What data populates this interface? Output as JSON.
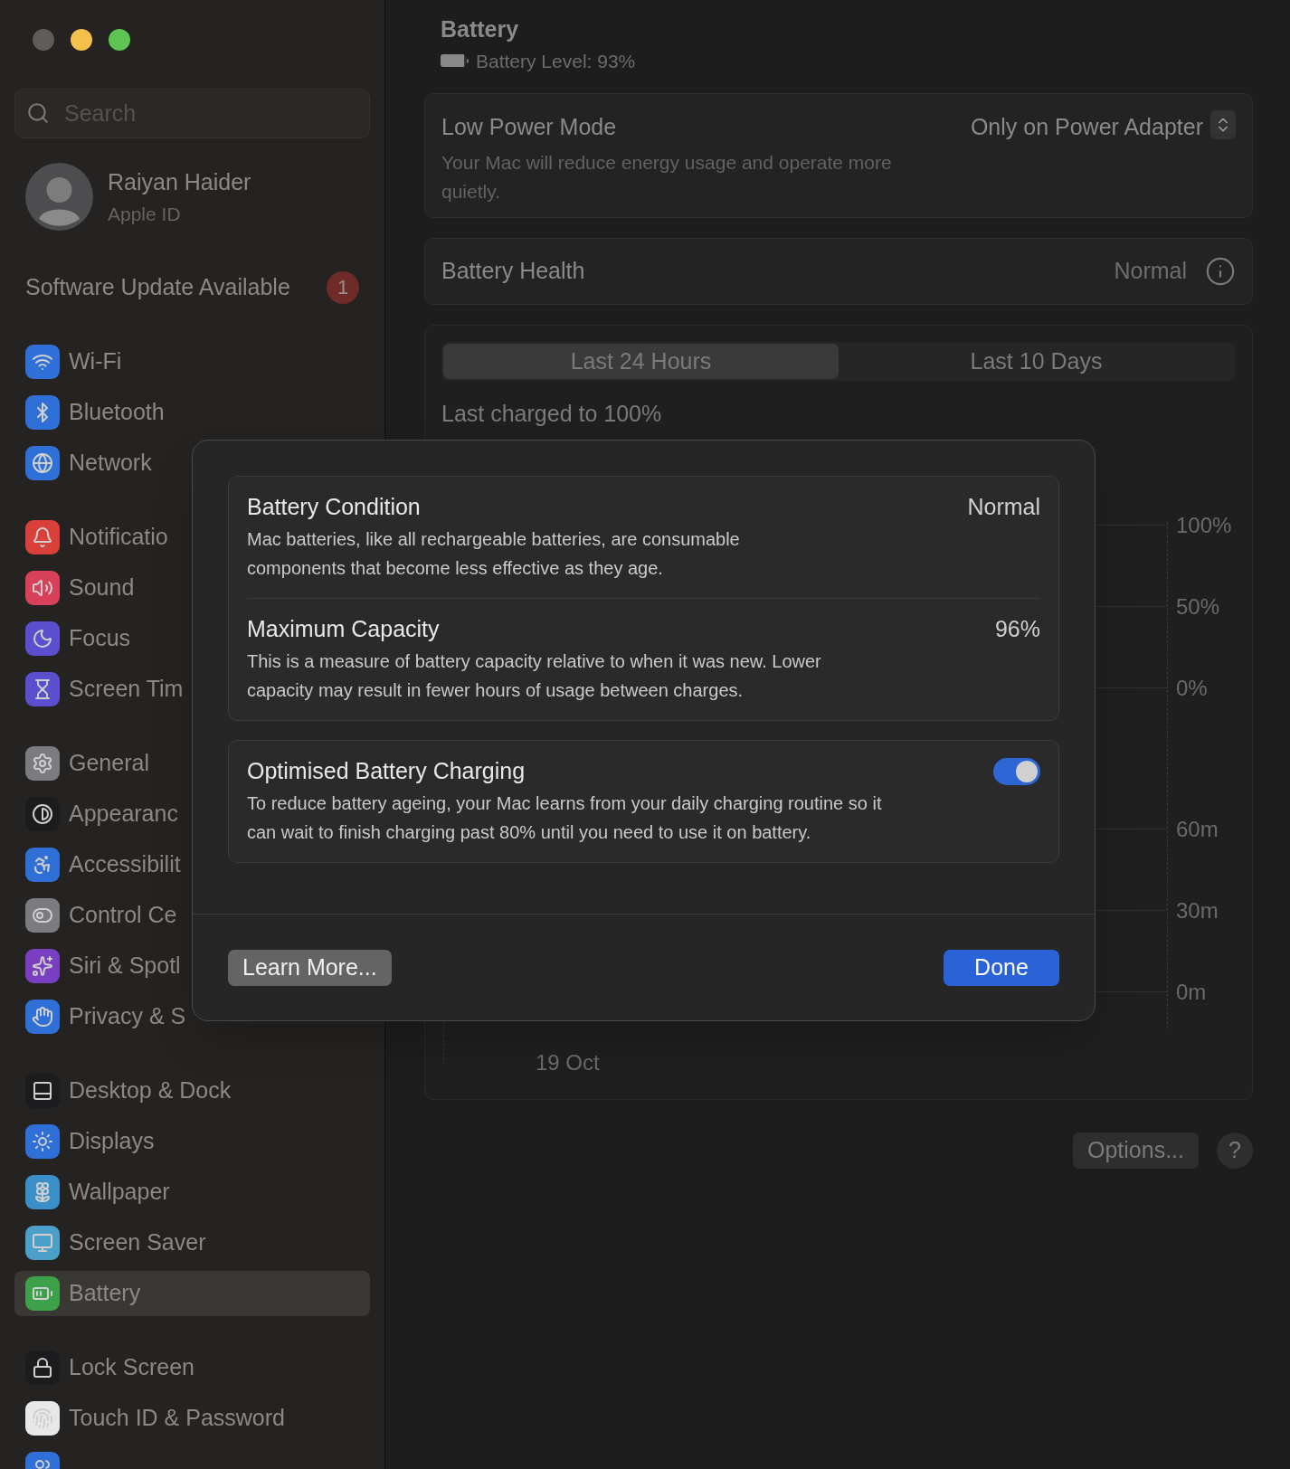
{
  "search": {
    "placeholder": "Search"
  },
  "account": {
    "name": "Raiyan Haider",
    "subtitle": "Apple ID"
  },
  "update": {
    "label": "Software Update Available",
    "count": "1"
  },
  "sidebar": {
    "groups": [
      [
        {
          "label": "Wi-Fi",
          "color": "#2f6fd8",
          "selected": false
        },
        {
          "label": "Bluetooth",
          "color": "#2f6fd8",
          "selected": false
        },
        {
          "label": "Network",
          "color": "#2f6fd8",
          "selected": false
        }
      ],
      [
        {
          "label": "Notificatio",
          "color": "#d9403a",
          "selected": false
        },
        {
          "label": "Sound",
          "color": "#d9405a",
          "selected": false
        },
        {
          "label": "Focus",
          "color": "#5b4fd0",
          "selected": false
        },
        {
          "label": "Screen Tim",
          "color": "#5b4fd0",
          "selected": false
        }
      ],
      [
        {
          "label": "General",
          "color": "#7c7c80",
          "selected": false
        },
        {
          "label": "Appearanc",
          "color": "#1c1c1e",
          "selected": false
        },
        {
          "label": "Accessibilit",
          "color": "#2f6fd8",
          "selected": false
        },
        {
          "label": "Control Ce",
          "color": "#7c7c80",
          "selected": false
        },
        {
          "label": "Siri & Spotl",
          "color": "#7a3fc0",
          "selected": false
        },
        {
          "label": "Privacy & S",
          "color": "#2f6fd8",
          "selected": false
        }
      ],
      [
        {
          "label": "Desktop & Dock",
          "color": "#1c1c1e",
          "selected": false
        },
        {
          "label": "Displays",
          "color": "#2f6fd8",
          "selected": false
        },
        {
          "label": "Wallpaper",
          "color": "#3a8fc9",
          "selected": false
        },
        {
          "label": "Screen Saver",
          "color": "#4aa0c8",
          "selected": false
        },
        {
          "label": "Battery",
          "color": "#3da14a",
          "selected": true
        }
      ],
      [
        {
          "label": "Lock Screen",
          "color": "#1c1c1e",
          "selected": false
        },
        {
          "label": "Touch ID & Password",
          "color": "#e8e8ea",
          "selected": false
        },
        {
          "color": "#2f6fd8",
          "selected": false
        }
      ]
    ]
  },
  "header": {
    "title": "Battery",
    "level_text": "Battery Level: 93%",
    "level": 0.93
  },
  "low_power": {
    "title": "Low Power Mode",
    "description": "Your Mac will reduce energy usage and operate more quietly.",
    "value": "Only on Power Adapter"
  },
  "health": {
    "title": "Battery Health",
    "value": "Normal"
  },
  "tabs": [
    {
      "label": "Last 24 Hours",
      "selected": true
    },
    {
      "label": "Last 10 Days",
      "selected": false
    }
  ],
  "last_charged": "Last charged to 100%",
  "chart": {
    "upper_labels": [
      "100%",
      "50%",
      "0%"
    ],
    "lower_labels": [
      "60m",
      "30m",
      "0m"
    ],
    "date_label": "19 Oct"
  },
  "footer": {
    "options": "Options...",
    "help": "?"
  },
  "dialog": {
    "sections": [
      [
        {
          "title": "Battery Condition",
          "value": "Normal",
          "description": "Mac batteries, like all rechargeable batteries, are consumable components that become less effective as they age."
        },
        {
          "title": "Maximum Capacity",
          "value": "96%",
          "description": "This is a measure of battery capacity relative to when it was new. Lower capacity may result in fewer hours of usage between charges."
        }
      ],
      [
        {
          "title": "Optimised Battery Charging",
          "on": true,
          "description": "To reduce battery ageing, your Mac learns from your daily charging routine so it can wait to finish charging past 80% until you need to use it on battery."
        }
      ]
    ],
    "secondary": "Learn More...",
    "primary": "Done"
  }
}
